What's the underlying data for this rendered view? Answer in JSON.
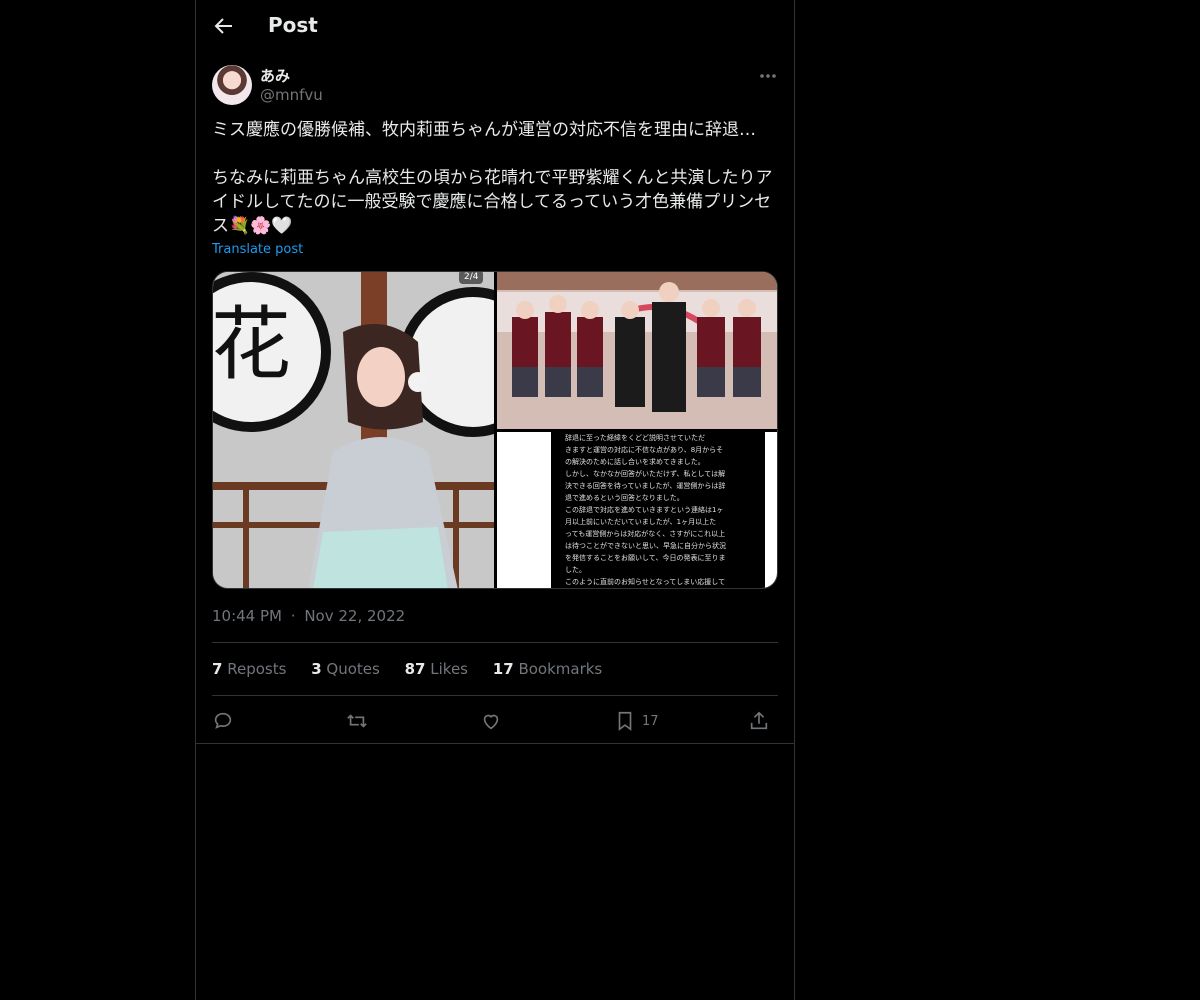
{
  "header": {
    "title": "Post"
  },
  "author": {
    "name": "あみ",
    "handle": "@mnfvu"
  },
  "post": {
    "text": "ミス慶應の優勝候補、牧内莉亜ちゃんが運営の対応不信を理由に辞退…\n\nちなみに莉亜ちゃん高校生の頃から花晴れで平野紫耀くんと共演したりアイドルしてたのに一般受験で慶應に合格してるっていう才色兼備プリンセス💐🌸🤍",
    "translate_label": "Translate post",
    "media_count_badge": "2/4",
    "screenshot_text": [
      "辞退に至った経緯をくどど説明させていただ",
      "きますと運営の対応に不信な点があり、8月からそ",
      "の解決のために話し合いを求めてきました。",
      "しかし、なかなか回答がいただけず、私としては解",
      "決できる回答を待っていましたが、運営側からは辞",
      "退で進めるという回答となりました。",
      "この辞退で対応を進めていきますという連絡は1ヶ",
      "月以上前にいただいていましたが、1ヶ月以上た",
      "っても運営側からは対応がなく、さすがにこれ以上",
      "は待つことができないと思い、早急に自分から状況",
      "を発信することをお願いして、今日の発表に至りま",
      "した。",
      "このように直前のお知らせとなってしまい応援して",
      "くださっている方には本当に申し訳ない気持ちでい"
    ],
    "time": "10:44 PM",
    "separator": "·",
    "date": "Nov 22, 2022"
  },
  "stats": [
    {
      "count": "7",
      "label": "Reposts"
    },
    {
      "count": "3",
      "label": "Quotes"
    },
    {
      "count": "87",
      "label": "Likes"
    },
    {
      "count": "17",
      "label": "Bookmarks"
    }
  ],
  "actions": {
    "reply_icon": "reply-icon",
    "repost_icon": "repost-icon",
    "like_icon": "heart-icon",
    "bookmark_icon": "bookmark-icon",
    "bookmark_count": "17",
    "share_icon": "share-icon"
  }
}
